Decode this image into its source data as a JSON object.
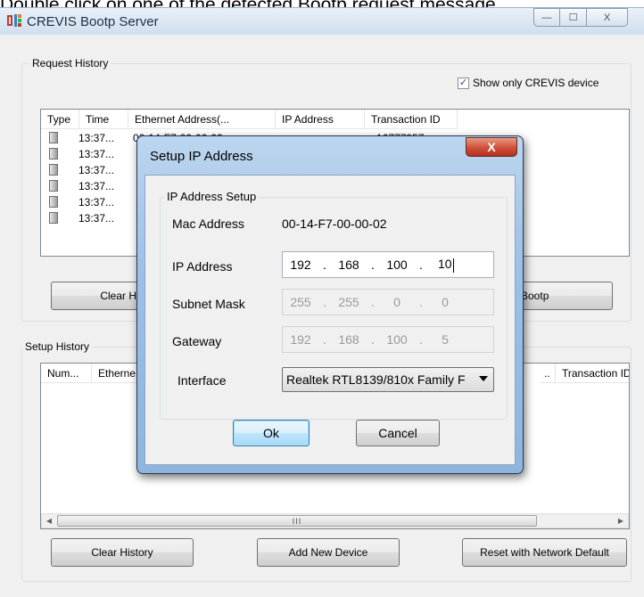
{
  "caption": "Double click on one of the detected Bootp request message",
  "window": {
    "title": "CREVIS Bootp Server",
    "min_symbol": "—",
    "max_symbol": "☐",
    "close_symbol": "X"
  },
  "request_history": {
    "legend": "Request History",
    "show_only_label": "Show only CREVIS device",
    "show_only_checked": true,
    "check_symbol": "✓",
    "columns": [
      "Type",
      "Time",
      "Ethernet Address(...",
      "IP Address",
      "Transaction ID"
    ],
    "rows": [
      {
        "time": "13:37...",
        "ethernet": "00-14-F7-00-00-02",
        "transaction": "16777957"
      },
      {
        "time": "13:37...",
        "ethernet": "",
        "transaction": ""
      },
      {
        "time": "13:37...",
        "ethernet": "",
        "transaction": ""
      },
      {
        "time": "13:37...",
        "ethernet": "",
        "transaction": ""
      },
      {
        "time": "13:37...",
        "ethernet": "",
        "transaction": ""
      },
      {
        "time": "13:37...",
        "ethernet": "",
        "transaction": ""
      }
    ],
    "clear_label": "Clear His",
    "stop_label": "p Bootp"
  },
  "setup_history": {
    "legend": "Setup History",
    "columns": [
      "Num...",
      "Etherne",
      "..",
      "Transaction ID"
    ],
    "scroll_grip": "III",
    "clear_label": "Clear History",
    "add_label": "Add New Device",
    "reset_label": "Reset with Network Default"
  },
  "dialog": {
    "title": "Setup IP Address",
    "close_symbol": "X",
    "group_label": "IP Address Setup",
    "mac_label": "Mac Address",
    "mac_value": "00-14-F7-00-00-02",
    "ip_label": "IP Address",
    "ip": [
      "192",
      "168",
      "100",
      "10"
    ],
    "subnet_label": "Subnet Mask",
    "subnet": [
      "255",
      "255",
      "0",
      "0"
    ],
    "gateway_label": "Gateway",
    "gateway": [
      "192",
      "168",
      "100",
      "5"
    ],
    "dot": ".",
    "interface_label": "Interface",
    "interface_value": "Realtek RTL8139/810x Family F",
    "ok_label": "Ok",
    "cancel_label": "Cancel"
  }
}
